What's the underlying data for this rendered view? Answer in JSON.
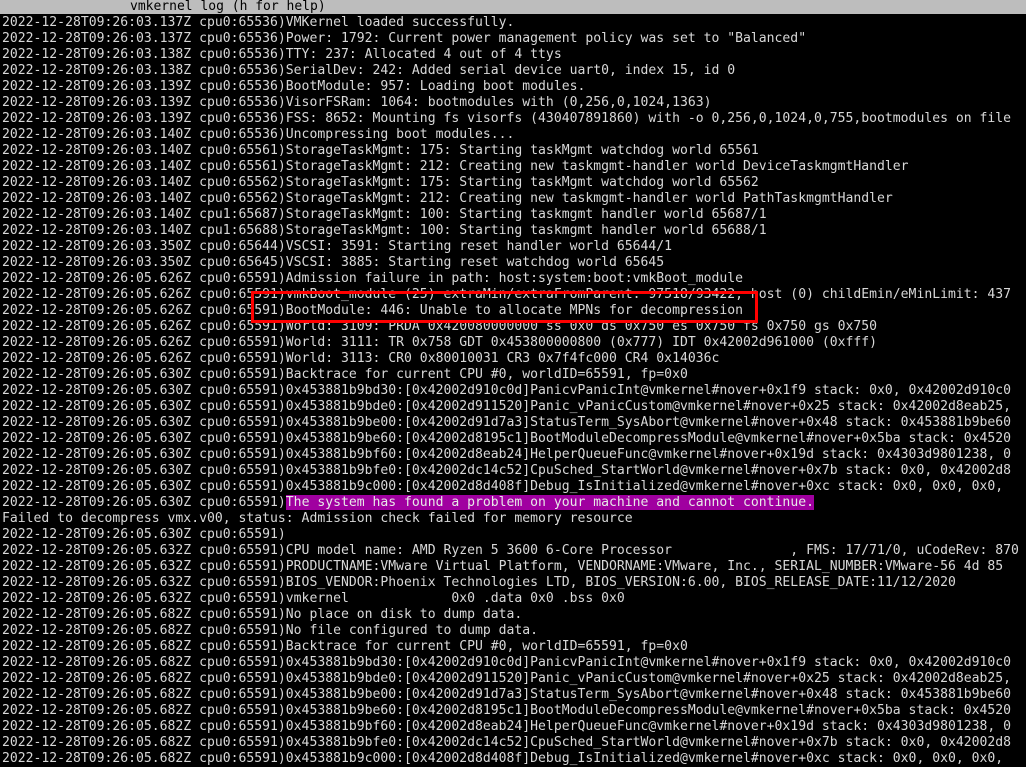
{
  "title_bar": {
    "label": "vmkernel log (h for help)"
  },
  "colors": {
    "background": "#000000",
    "text": "#d8d8d8",
    "title_bar_bg": "#bdbdbd",
    "highlight_bg": "#a000a0",
    "annotation_border": "#ff0000"
  },
  "log": {
    "lines": [
      {
        "prefix": "2022-12-28T09:26:03.137Z cpu0:65536)VMKernel loaded successfully.",
        "highlight": ""
      },
      {
        "prefix": "2022-12-28T09:26:03.137Z cpu0:65536)Power: 1792: Current power management policy was set to \"Balanced\"",
        "highlight": ""
      },
      {
        "prefix": "2022-12-28T09:26:03.138Z cpu0:65536)TTY: 237: Allocated 4 out of 4 ttys",
        "highlight": ""
      },
      {
        "prefix": "2022-12-28T09:26:03.138Z cpu0:65536)SerialDev: 242: Added serial device uart0, index 15, id 0",
        "highlight": ""
      },
      {
        "prefix": "2022-12-28T09:26:03.139Z cpu0:65536)BootModule: 957: Loading boot modules.",
        "highlight": ""
      },
      {
        "prefix": "2022-12-28T09:26:03.139Z cpu0:65536)VisorFSRam: 1064: bootmodules with (0,256,0,1024,1363)",
        "highlight": ""
      },
      {
        "prefix": "2022-12-28T09:26:03.139Z cpu0:65536)FSS: 8652: Mounting fs visorfs (430407891860) with -o 0,256,0,1024,0,755,bootmodules on file",
        "highlight": ""
      },
      {
        "prefix": "2022-12-28T09:26:03.140Z cpu0:65536)Uncompressing boot modules...",
        "highlight": ""
      },
      {
        "prefix": "2022-12-28T09:26:03.140Z cpu0:65561)StorageTaskMgmt: 175: Starting taskMgmt watchdog world 65561",
        "highlight": ""
      },
      {
        "prefix": "2022-12-28T09:26:03.140Z cpu0:65561)StorageTaskMgmt: 212: Creating new taskmgmt-handler world DeviceTaskmgmtHandler",
        "highlight": ""
      },
      {
        "prefix": "2022-12-28T09:26:03.140Z cpu0:65562)StorageTaskMgmt: 175: Starting taskMgmt watchdog world 65562",
        "highlight": ""
      },
      {
        "prefix": "2022-12-28T09:26:03.140Z cpu0:65562)StorageTaskMgmt: 212: Creating new taskmgmt-handler world PathTaskmgmtHandler",
        "highlight": ""
      },
      {
        "prefix": "2022-12-28T09:26:03.140Z cpu1:65687)StorageTaskMgmt: 100: Starting taskmgmt handler world 65687/1",
        "highlight": ""
      },
      {
        "prefix": "2022-12-28T09:26:03.140Z cpu1:65688)StorageTaskMgmt: 100: Starting taskmgmt handler world 65688/1",
        "highlight": ""
      },
      {
        "prefix": "2022-12-28T09:26:03.350Z cpu0:65644)VSCSI: 3591: Starting reset handler world 65644/1",
        "highlight": ""
      },
      {
        "prefix": "2022-12-28T09:26:03.350Z cpu0:65645)VSCSI: 3885: Starting reset watchdog world 65645",
        "highlight": ""
      },
      {
        "prefix": "2022-12-28T09:26:05.626Z cpu0:65591)Admission failure in path: host:system:boot:vmkBoot_module",
        "highlight": ""
      },
      {
        "prefix": "2022-12-28T09:26:05.626Z cpu0:65591)vmkBoot_module (25) extraMin/extraFromParent: 97518/93422, host (0) childEmin/eMinLimit: 437",
        "highlight": ""
      },
      {
        "prefix": "2022-12-28T09:26:05.626Z cpu0:65591)BootModule: 446: Unable to allocate MPNs for decompression",
        "highlight": ""
      },
      {
        "prefix": "2022-12-28T09:26:05.626Z cpu0:65591)World: 3109: PRDA 0x420080000000 ss 0x0 ds 0x750 es 0x750 fs 0x750 gs 0x750",
        "highlight": ""
      },
      {
        "prefix": "2022-12-28T09:26:05.626Z cpu0:65591)World: 3111: TR 0x758 GDT 0x453800000800 (0x777) IDT 0x42002d961000 (0xfff)",
        "highlight": ""
      },
      {
        "prefix": "2022-12-28T09:26:05.626Z cpu0:65591)World: 3113: CR0 0x80010031 CR3 0x7f4fc000 CR4 0x14036c",
        "highlight": ""
      },
      {
        "prefix": "2022-12-28T09:26:05.630Z cpu0:65591)Backtrace for current CPU #0, worldID=65591, fp=0x0",
        "highlight": ""
      },
      {
        "prefix": "2022-12-28T09:26:05.630Z cpu0:65591)0x453881b9bd30:[0x42002d910c0d]PanicvPanicInt@vmkernel#nover+0x1f9 stack: 0x0, 0x42002d910c0",
        "highlight": ""
      },
      {
        "prefix": "2022-12-28T09:26:05.630Z cpu0:65591)0x453881b9bde0:[0x42002d911520]Panic_vPanicCustom@vmkernel#nover+0x25 stack: 0x42002d8eab25,",
        "highlight": ""
      },
      {
        "prefix": "2022-12-28T09:26:05.630Z cpu0:65591)0x453881b9be00:[0x42002d91d7a3]StatusTerm_SysAbort@vmkernel#nover+0x48 stack: 0x453881b9be60",
        "highlight": ""
      },
      {
        "prefix": "2022-12-28T09:26:05.630Z cpu0:65591)0x453881b9be60:[0x42002d8195c1]BootModuleDecompressModule@vmkernel#nover+0x5ba stack: 0x4520",
        "highlight": ""
      },
      {
        "prefix": "2022-12-28T09:26:05.630Z cpu0:65591)0x453881b9bf60:[0x42002d8eab24]HelperQueueFunc@vmkernel#nover+0x19d stack: 0x4303d9801238, 0",
        "highlight": ""
      },
      {
        "prefix": "2022-12-28T09:26:05.630Z cpu0:65591)0x453881b9bfe0:[0x42002dc14c52]CpuSched_StartWorld@vmkernel#nover+0x7b stack: 0x0, 0x42002d8",
        "highlight": ""
      },
      {
        "prefix": "2022-12-28T09:26:05.630Z cpu0:65591)0x453881b9c000:[0x42002d8d408f]Debug_IsInitialized@vmkernel#nover+0xc stack: 0x0, 0x0, 0x0,",
        "highlight": ""
      },
      {
        "prefix": "2022-12-28T09:26:05.630Z cpu0:65591)",
        "highlight": "The system has found a problem on your machine and cannot continue."
      },
      {
        "prefix": "Failed to decompress vmx.v00, status: Admission check failed for memory resource",
        "highlight": ""
      },
      {
        "prefix": "2022-12-28T09:26:05.630Z cpu0:65591)",
        "highlight": ""
      },
      {
        "prefix": "2022-12-28T09:26:05.632Z cpu0:65591)CPU model name: AMD Ryzen 5 3600 6-Core Processor               , FMS: 17/71/0, uCodeRev: 870",
        "highlight": ""
      },
      {
        "prefix": "2022-12-28T09:26:05.632Z cpu0:65591)PRODUCTNAME:VMware Virtual Platform, VENDORNAME:VMware, Inc., SERIAL_NUMBER:VMware-56 4d 85",
        "highlight": ""
      },
      {
        "prefix": "2022-12-28T09:26:05.632Z cpu0:65591)BIOS_VENDOR:Phoenix Technologies LTD, BIOS_VERSION:6.00, BIOS_RELEASE_DATE:11/12/2020",
        "highlight": ""
      },
      {
        "prefix": "2022-12-28T09:26:05.632Z cpu0:65591)vmkernel             0x0 .data 0x0 .bss 0x0",
        "highlight": ""
      },
      {
        "prefix": "2022-12-28T09:26:05.682Z cpu0:65591)No place on disk to dump data.",
        "highlight": ""
      },
      {
        "prefix": "2022-12-28T09:26:05.682Z cpu0:65591)No file configured to dump data.",
        "highlight": ""
      },
      {
        "prefix": "2022-12-28T09:26:05.682Z cpu0:65591)Backtrace for current CPU #0, worldID=65591, fp=0x0",
        "highlight": ""
      },
      {
        "prefix": "2022-12-28T09:26:05.682Z cpu0:65591)0x453881b9bd30:[0x42002d910c0d]PanicvPanicInt@vmkernel#nover+0x1f9 stack: 0x0, 0x42002d910c0",
        "highlight": ""
      },
      {
        "prefix": "2022-12-28T09:26:05.682Z cpu0:65591)0x453881b9bde0:[0x42002d911520]Panic_vPanicCustom@vmkernel#nover+0x25 stack: 0x42002d8eab25,",
        "highlight": ""
      },
      {
        "prefix": "2022-12-28T09:26:05.682Z cpu0:65591)0x453881b9be00:[0x42002d91d7a3]StatusTerm_SysAbort@vmkernel#nover+0x48 stack: 0x453881b9be60",
        "highlight": ""
      },
      {
        "prefix": "2022-12-28T09:26:05.682Z cpu0:65591)0x453881b9be60:[0x42002d8195c1]BootModuleDecompressModule@vmkernel#nover+0x5ba stack: 0x4520",
        "highlight": ""
      },
      {
        "prefix": "2022-12-28T09:26:05.682Z cpu0:65591)0x453881b9bf60:[0x42002d8eab24]HelperQueueFunc@vmkernel#nover+0x19d stack: 0x4303d9801238, 0",
        "highlight": ""
      },
      {
        "prefix": "2022-12-28T09:26:05.682Z cpu0:65591)0x453881b9bfe0:[0x42002dc14c52]CpuSched_StartWorld@vmkernel#nover+0x7b stack: 0x0, 0x42002d8",
        "highlight": ""
      },
      {
        "prefix": "2022-12-28T09:26:05.682Z cpu0:65591)0x453881b9c000:[0x42002d8d408f]Debug_IsInitialized@vmkernel#nover+0xc stack: 0x0, 0x0, 0x0,",
        "highlight": ""
      }
    ]
  }
}
